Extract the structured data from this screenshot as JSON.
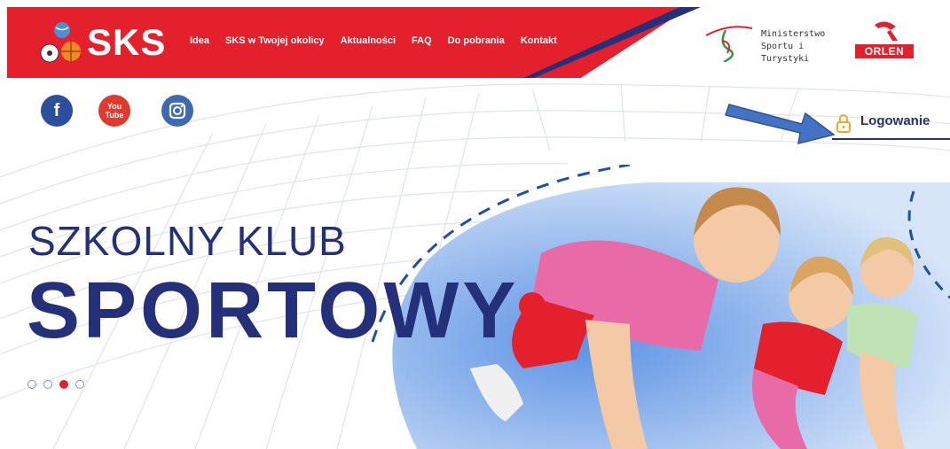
{
  "header": {
    "logo_text": "SKS",
    "nav": [
      "Idea",
      "SKS w Twojej okolicy",
      "Aktualności",
      "FAQ",
      "Do pobrania",
      "Kontakt"
    ],
    "ministry_line1": "Ministerstwo",
    "ministry_line2": "Sportu i Turystyki",
    "sponsor": "ORLEN"
  },
  "social": {
    "facebook_glyph": "f",
    "youtube_glyph": "You Tube",
    "instagram_icon": "instagram-icon"
  },
  "login": {
    "label": "Logowanie"
  },
  "hero": {
    "line1": "SZKOLNY KLUB",
    "line2": "SPORTOWY",
    "slides_count": 4,
    "active_slide": 3
  },
  "colors": {
    "brand_red": "#e3202c",
    "brand_navy": "#25307a",
    "arrow_blue": "#4472c4"
  }
}
